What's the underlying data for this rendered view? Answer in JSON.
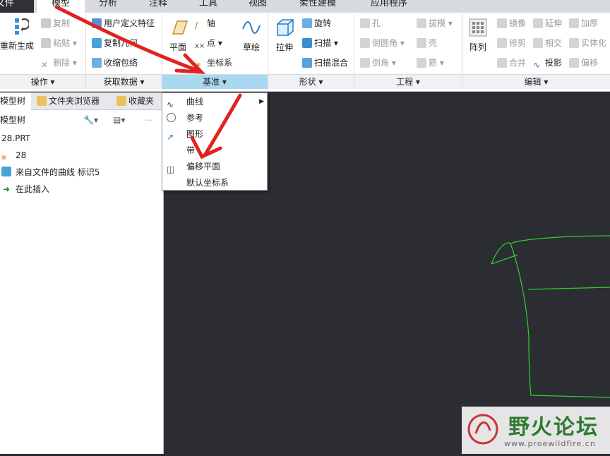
{
  "tabs": [
    "文件",
    "模型",
    "分析",
    "注释",
    "工具",
    "视图",
    "柔性建模",
    "应用程序"
  ],
  "ribbon": {
    "op_regen": "重新生成",
    "op_copy": "复制",
    "op_paste": "粘贴",
    "op_delete": "删除",
    "get_udf": "用户定义特征",
    "get_copy_geom": "复制几何",
    "get_shrink": "收缩包络",
    "datum_plane": "平面",
    "datum_axis": "轴",
    "datum_point": "点",
    "datum_csys": "坐标系",
    "datum_sketch": "草绘",
    "shape_extrude": "拉伸",
    "shape_revolve": "旋转",
    "shape_sweep": "扫描",
    "shape_blend": "扫描混合",
    "eng_hole": "孔",
    "eng_round": "倒圆角",
    "eng_chamfer": "倒角",
    "eng_draft": "拔模",
    "eng_shell": "壳",
    "eng_rib": "筋",
    "edit_pattern": "阵列",
    "edit_mirror": "镜像",
    "edit_trim": "修剪",
    "edit_merge": "合并",
    "edit_extend": "延伸",
    "edit_intersect": "相交",
    "edit_project": "投影",
    "edit_thicken": "加厚",
    "edit_solidify": "实体化",
    "edit_offset": "偏移"
  },
  "groups": [
    "操作",
    "获取数据",
    "基准",
    "形状",
    "工程",
    "编辑"
  ],
  "panel": {
    "tabs": [
      "模型树",
      "文件夹浏览器",
      "收藏夹"
    ],
    "tree_title": "模型树",
    "items": [
      "28.PRT",
      "28",
      "来自文件的曲线 标识5",
      "在此插入"
    ]
  },
  "menu": {
    "items": [
      "曲线",
      "参考",
      "图形",
      "带",
      "偏移平面",
      "默认坐标系"
    ]
  },
  "watermark": {
    "title": "野火论坛",
    "url": "www.proewildfire.cn"
  },
  "colors": {
    "accent": "#a9d9f2",
    "arrow": "#e0231f",
    "curve": "#2fd02f",
    "canvas": "#2b2d33"
  }
}
